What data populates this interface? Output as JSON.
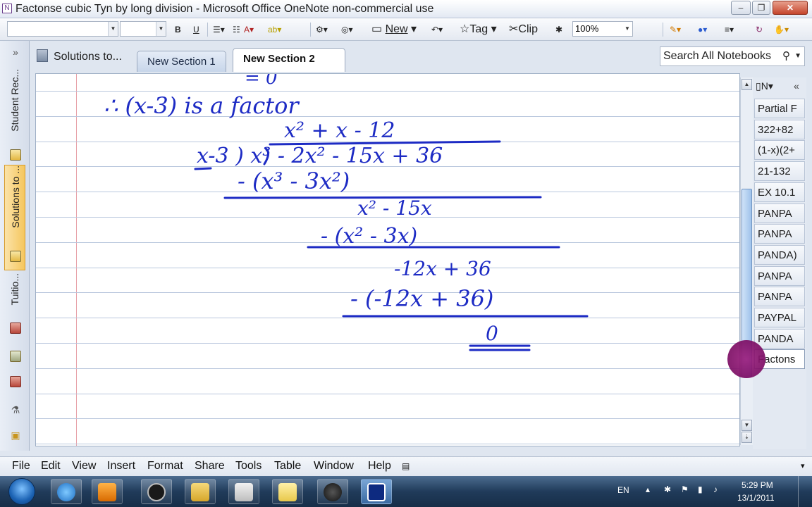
{
  "window": {
    "title": "Factonse cubic Tyn by long division - Microsoft Office OneNote non-commercial use"
  },
  "toolbar": {
    "bold": "B",
    "underline": "U",
    "new_label": "New",
    "tag_label": "Tag",
    "clip_label": "Clip",
    "zoom": "100%"
  },
  "nav": {
    "notebooks": [
      "Student Rec...",
      "Solutions to ...",
      "Tuitio..."
    ]
  },
  "tabs": {
    "notebook_name": "Solutions to...",
    "sections": [
      "New Section 1",
      "New Section 2"
    ]
  },
  "search": {
    "placeholder": "Search All Notebooks"
  },
  "pages": {
    "header": "N",
    "items": [
      "Partial F",
      "322+82",
      "(1-x)(2+",
      "21-132",
      "EX 10.1",
      "PANPA",
      "PANPA",
      "PANDA)",
      "PANPA",
      "PANPA",
      "PAYPAL",
      "PANDA",
      "Factons"
    ],
    "active_index": 12
  },
  "note": {
    "lines": [
      "= 0",
      "∴ (x-3) is a factor",
      "x² + x - 12",
      "x-3 ) x³ - 2x² - 15x + 36",
      "- (x³ - 3x²)",
      "x² - 15x",
      "- (x² - 3x)",
      "-12x + 36",
      "- (-12x + 36)",
      "0"
    ]
  },
  "menu": {
    "items": [
      "File",
      "Edit",
      "View",
      "Insert",
      "Format",
      "Share",
      "Tools",
      "Table",
      "Window",
      "Help"
    ]
  },
  "tray": {
    "language": "EN",
    "time": "5:29 PM",
    "date": "13/1/2011"
  },
  "colors": {
    "ink": "#1d2bc4",
    "active_tab": "#f5c65e",
    "cursor": "#7c0d64"
  }
}
